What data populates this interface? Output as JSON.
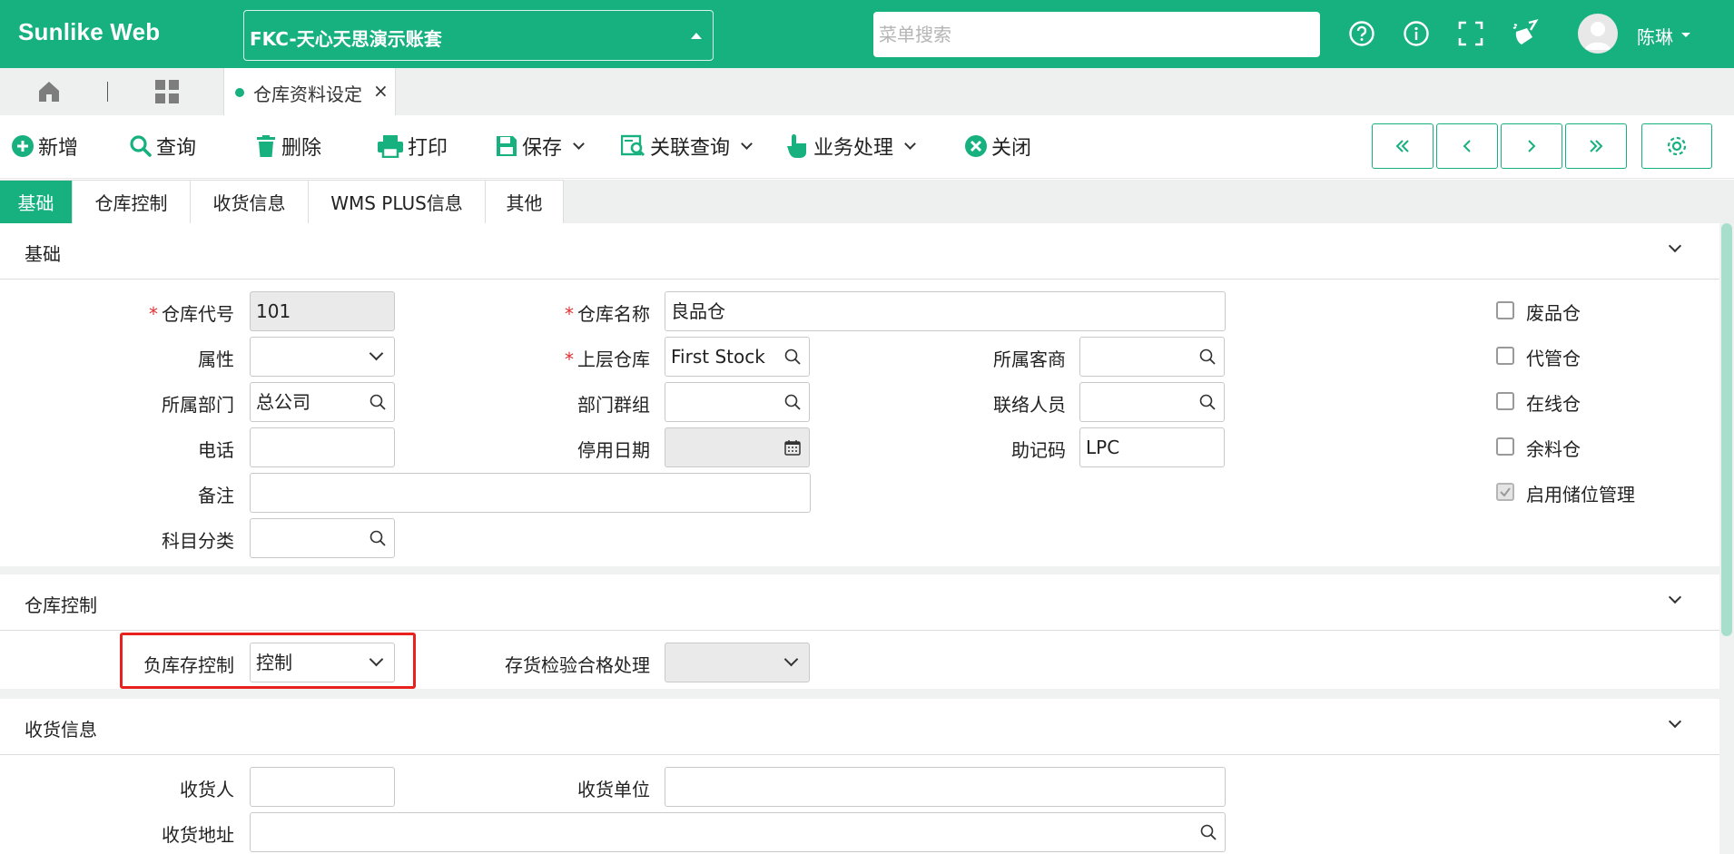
{
  "app": {
    "brand": "Sunlike Web",
    "account": "FKC-天心天思演示账套",
    "search_placeholder": "菜单搜索",
    "user": "陈琳",
    "accent": "#17b07f"
  },
  "tabs": {
    "open_tab": "仓库资料设定",
    "close": "×"
  },
  "toolbar": {
    "new": "新增",
    "query": "查询",
    "delete": "删除",
    "print": "打印",
    "save": "保存",
    "related": "关联查询",
    "business": "业务处理",
    "close": "关闭"
  },
  "form_tabs": [
    "基础",
    "仓库控制",
    "收货信息",
    "WMS PLUS信息",
    "其他"
  ],
  "basic": {
    "title": "基础",
    "warehouse_code_label": "仓库代号",
    "warehouse_code": "101",
    "warehouse_name_label": "仓库名称",
    "warehouse_name": "良品仓",
    "attribute_label": "属性",
    "attribute": "",
    "parent_label": "上层仓库",
    "parent": "First Stock",
    "customer_label": "所属客商",
    "customer": "",
    "dept_label": "所属部门",
    "dept": "总公司",
    "dept_group_label": "部门群组",
    "dept_group": "",
    "contact_label": "联络人员",
    "contact": "",
    "phone_label": "电话",
    "phone": "",
    "disable_date_label": "停用日期",
    "disable_date": "",
    "mnemonic_label": "助记码",
    "mnemonic": "LPC",
    "remark_label": "备注",
    "remark": "",
    "subject_label": "科目分类",
    "subject": "",
    "checkboxes": [
      {
        "label": "废品仓",
        "checked": false
      },
      {
        "label": "代管仓",
        "checked": false
      },
      {
        "label": "在线仓",
        "checked": false
      },
      {
        "label": "余料仓",
        "checked": false
      },
      {
        "label": "启用储位管理",
        "checked": true
      }
    ]
  },
  "control": {
    "title": "仓库控制",
    "negative_stock_label": "负库存控制",
    "negative_stock": "控制",
    "inspection_label": "存货检验合格处理",
    "inspection": ""
  },
  "receipt": {
    "title": "收货信息",
    "receiver_label": "收货人",
    "receiver": "",
    "receiver_unit_label": "收货单位",
    "receiver_unit": "",
    "address_label": "收货地址",
    "address": ""
  }
}
